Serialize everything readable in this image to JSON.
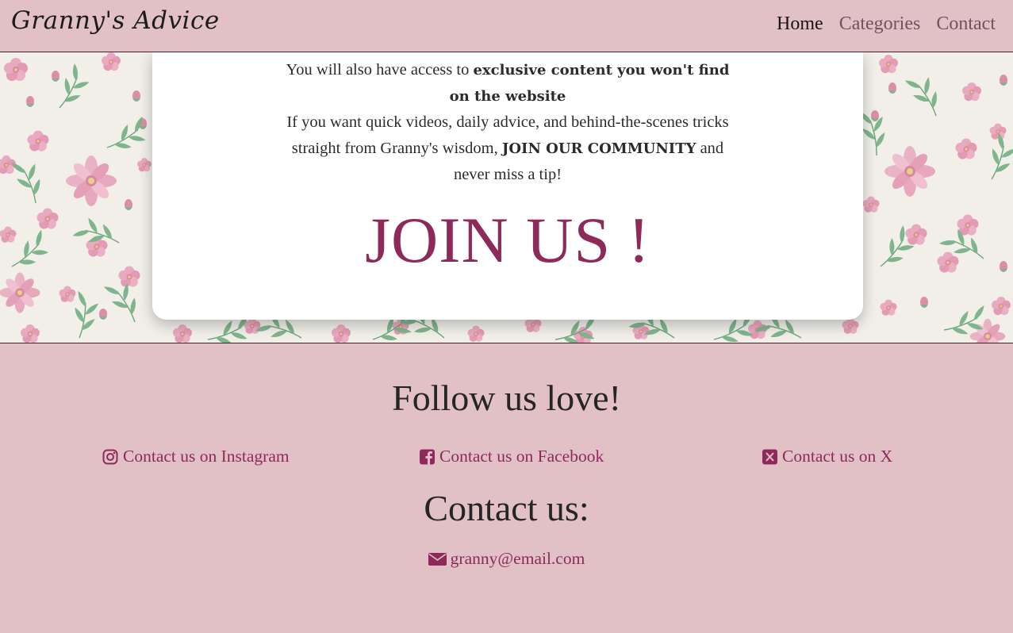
{
  "navbar": {
    "brand": "Granny's Advice",
    "links": [
      {
        "label": "Home"
      },
      {
        "label": "Categories"
      },
      {
        "label": "Contact"
      }
    ]
  },
  "hero": {
    "line1_prefix": "You will also have access to ",
    "line1_bold": "exclusive content you won't find on the website",
    "line2_prefix": "If you want quick videos, daily advice, and behind-the-scenes tricks straight from Granny's wisdom, ",
    "line2_bold": "JOIN OUR COMMUNITY",
    "line2_suffix": " and never miss a tip!",
    "join_label": "JOIN US !"
  },
  "footer": {
    "follow_title": "Follow us love!",
    "socials": [
      {
        "label": "Contact us on Instagram",
        "icon": "instagram-icon"
      },
      {
        "label": "Contact us on Facebook",
        "icon": "facebook-icon"
      },
      {
        "label": "Contact us on X",
        "icon": "x-icon"
      }
    ],
    "contact_title": "Contact us:",
    "email": "granny@email.com",
    "email_icon": "envelope-icon"
  },
  "colors": {
    "background": "#e1c0c6",
    "accent": "#8d2a5a",
    "card": "#ffffff",
    "floral_bg": "#f1efe8"
  }
}
